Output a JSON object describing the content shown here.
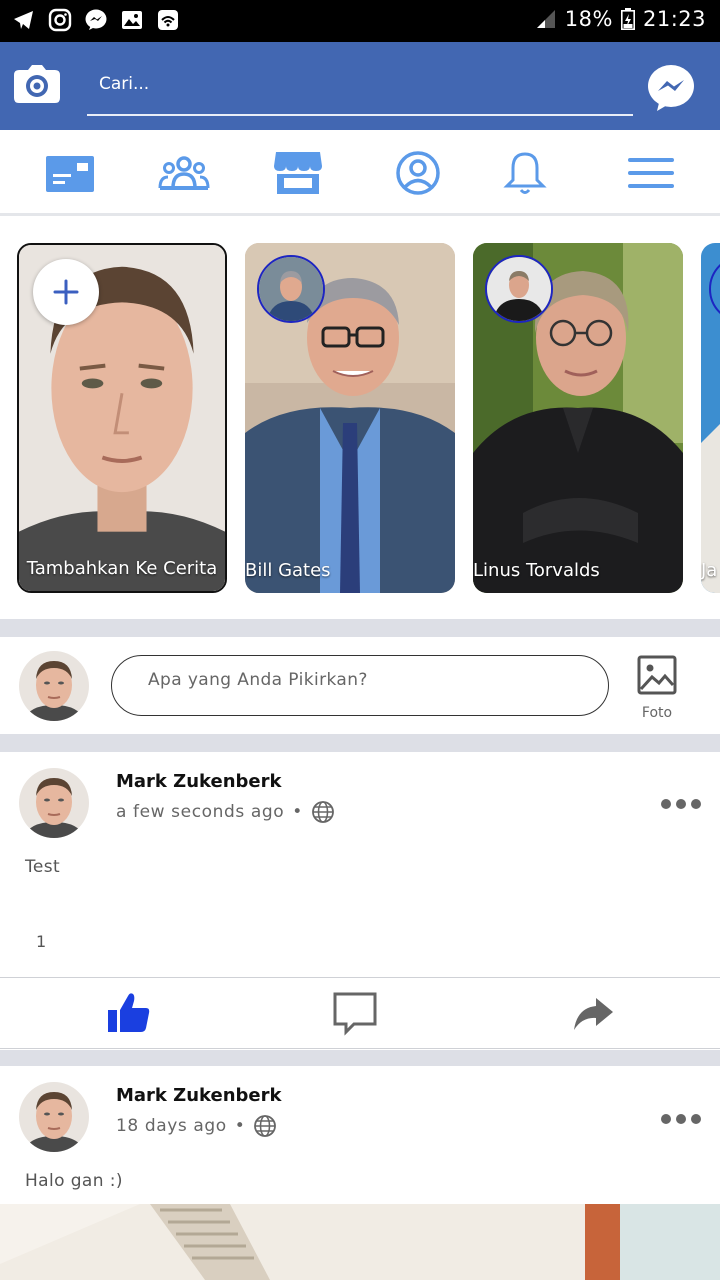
{
  "status_bar": {
    "battery": "18%",
    "time": "21:23",
    "left_icons": [
      "telegram-icon",
      "instagram-icon",
      "messenger-icon",
      "gallery-icon",
      "wifi-hotspot-icon"
    ]
  },
  "appbar": {
    "search_text": "Cari...",
    "color": "#4267b2"
  },
  "nav": {
    "items": [
      "news-feed-icon",
      "friends-icon",
      "marketplace-icon",
      "profile-icon",
      "notifications-icon",
      "menu-icon"
    ],
    "icon_color": "#5b9ae9"
  },
  "stories": [
    {
      "label": "Tambahkan Ke Cerita"
    },
    {
      "label": "Bill Gates"
    },
    {
      "label": "Linus Torvalds"
    },
    {
      "label": "Ja"
    }
  ],
  "composer": {
    "placeholder": "Apa yang Anda Pikirkan?",
    "photo_label": "Foto"
  },
  "posts": [
    {
      "author": "Mark Zukenberk",
      "time": "a few seconds ago",
      "separator": "•",
      "text": "Test",
      "like_count": "1",
      "liked": true
    },
    {
      "author": "Mark Zukenberk",
      "time": "18 days ago",
      "separator": "•",
      "text": "Halo gan :)"
    }
  ],
  "colors": {
    "like_active": "#1a3fe0",
    "action_gray": "#666666"
  }
}
